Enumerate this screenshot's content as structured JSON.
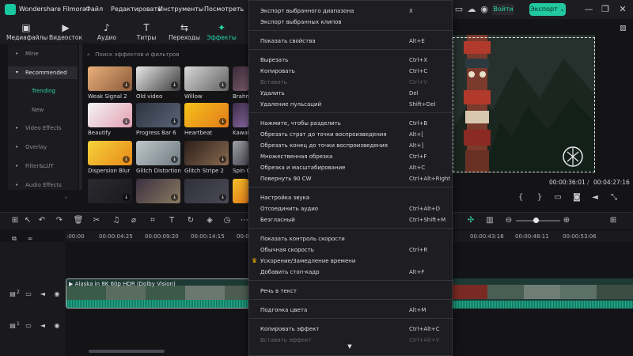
{
  "app": {
    "title": "Wondershare Filmora",
    "menu": [
      "Файл",
      "Редактировать",
      "Инструменты",
      "Посмотреть"
    ],
    "login_label": "Войти",
    "export_label": "Экспорт",
    "export_arrow": "⌄"
  },
  "media_tabs": [
    {
      "label": "Медиафайлы",
      "icon": "media-icon",
      "glyph": "▣"
    },
    {
      "label": "Видеосток",
      "icon": "stock-video-icon",
      "glyph": "▶"
    },
    {
      "label": "Аудио",
      "icon": "music-note-icon",
      "glyph": "♪"
    },
    {
      "label": "Титры",
      "icon": "title-icon",
      "glyph": "T"
    },
    {
      "label": "Переходы",
      "icon": "transition-icon",
      "glyph": "⇆"
    },
    {
      "label": "Эффекты",
      "icon": "effects-icon",
      "glyph": "✦"
    }
  ],
  "sidebar": {
    "items": [
      "Mine",
      "Recommended",
      "Video Effects",
      "Overlay",
      "Filter&LUT",
      "Audio Effects"
    ],
    "sub_items": [
      "Trending",
      "New"
    ]
  },
  "search": {
    "placeholder": "Поиск эффектов и фильтров"
  },
  "effects": [
    {
      "label": "Weak Signal 2"
    },
    {
      "label": "Old video"
    },
    {
      "label": "Willow"
    },
    {
      "label": "Brahm"
    },
    {
      "label": "Beautify"
    },
    {
      "label": "Progress Bar 6"
    },
    {
      "label": "Heartbeat"
    },
    {
      "label": "Kawaii"
    },
    {
      "label": "Dispersion Blur"
    },
    {
      "label": "Glitch Distortion"
    },
    {
      "label": "Glitch Stripe 2"
    },
    {
      "label": "Spin Ov"
    }
  ],
  "context_menu": {
    "groups": [
      [
        {
          "label": "Экспорт выбранного диапазона",
          "shortcut": "X",
          "disabled": false
        },
        {
          "label": "Экспорт выбранных клипов",
          "shortcut": "",
          "disabled": false
        }
      ],
      [
        {
          "label": "Показать свойства",
          "shortcut": "Alt+E",
          "disabled": false
        }
      ],
      [
        {
          "label": "Вырезать",
          "shortcut": "Ctrl+X",
          "disabled": false
        },
        {
          "label": "Копировать",
          "shortcut": "Ctrl+C",
          "disabled": false
        },
        {
          "label": "Вставить",
          "shortcut": "Ctrl+V",
          "disabled": true
        },
        {
          "label": "Удалить",
          "shortcut": "Del",
          "disabled": false
        },
        {
          "label": "Удаление пульсаций",
          "shortcut": "Shift+Del",
          "disabled": false
        }
      ],
      [
        {
          "label": "Нажмите, чтобы разделить",
          "shortcut": "Ctrl+B",
          "disabled": false
        },
        {
          "label": "Обрезать страт до точки воспроизведения",
          "shortcut": "Alt+[",
          "disabled": false
        },
        {
          "label": "Обрезать конец до точки воспроизведения",
          "shortcut": "Alt+]",
          "disabled": false
        },
        {
          "label": "Множественная обрезка",
          "shortcut": "Ctrl+F",
          "disabled": false
        },
        {
          "label": "Обрезка и масштабирование",
          "shortcut": "Alt+C",
          "disabled": false
        },
        {
          "label": "Повернуть 90 CW",
          "shortcut": "Ctrl+Alt+Right",
          "disabled": false
        }
      ],
      [
        {
          "label": "Настройка звука",
          "shortcut": "",
          "disabled": false
        },
        {
          "label": "Отсоединить аудио",
          "shortcut": "Ctrl+Alt+D",
          "disabled": false
        },
        {
          "label": "Безгласный",
          "shortcut": "Ctrl+Shift+M",
          "disabled": false
        }
      ],
      [
        {
          "label": "Показать контроль скорости",
          "shortcut": "",
          "disabled": false
        },
        {
          "label": "Обычная скорость",
          "shortcut": "Ctrl+R",
          "disabled": false
        },
        {
          "label": "Ускорение/Замедление времени",
          "shortcut": "",
          "disabled": false,
          "premium": true
        },
        {
          "label": "Добавить стоп-кадр",
          "shortcut": "Alt+F",
          "disabled": false
        }
      ],
      [
        {
          "label": "Речь в текст",
          "shortcut": "",
          "disabled": false
        }
      ],
      [
        {
          "label": "Подгонка цвета",
          "shortcut": "Alt+M",
          "disabled": false
        }
      ],
      [
        {
          "label": "Копировать эффект",
          "shortcut": "Ctrl+Alt+C",
          "disabled": false
        },
        {
          "label": "Вставить эффект",
          "shortcut": "Ctrl+Alt+V",
          "disabled": true
        }
      ]
    ],
    "more_glyph": "▼"
  },
  "preview": {
    "current_time": "00:00:36:01",
    "separator": "/",
    "total_time": "00:04:27:16"
  },
  "timeline": {
    "ruler_labels": [
      ":00:00",
      "00:00:04:25",
      "00:00:09:20",
      "00:00:14:15",
      "00:00:1",
      "00:00:43:16",
      "00:00:48:11",
      "00:00:53:06"
    ],
    "clip_title": "Alaska in 8K 60p HDR (Dolby Vision)",
    "track_numbers": [
      "2",
      "1"
    ]
  },
  "colors": {
    "accent": "#21c8a0",
    "premium": "#f5b400"
  }
}
